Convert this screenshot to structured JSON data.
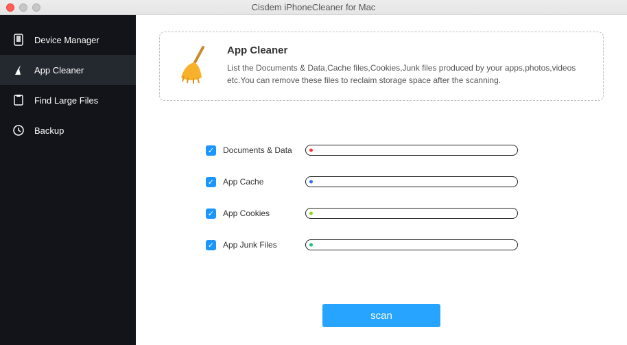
{
  "window": {
    "title": "Cisdem iPhoneCleaner for Mac"
  },
  "sidebar": {
    "items": [
      {
        "label": "Device Manager",
        "active": false
      },
      {
        "label": "App Cleaner",
        "active": true
      },
      {
        "label": "Find Large Files",
        "active": false
      },
      {
        "label": "Backup",
        "active": false
      }
    ]
  },
  "info": {
    "title": "App Cleaner",
    "description": "List the Documents & Data,Cache files,Cookies,Junk files produced by your apps,photos,videos etc.You can remove these files to reclaim storage space after the scanning."
  },
  "categories": [
    {
      "label": "Documents & Data",
      "checked": true,
      "dot_color": "#ff3131"
    },
    {
      "label": "App Cache",
      "checked": true,
      "dot_color": "#2f6bff"
    },
    {
      "label": "App Cookies",
      "checked": true,
      "dot_color": "#8dd717"
    },
    {
      "label": "App Junk Files",
      "checked": true,
      "dot_color": "#16c079"
    }
  ],
  "scan_button": "scan"
}
